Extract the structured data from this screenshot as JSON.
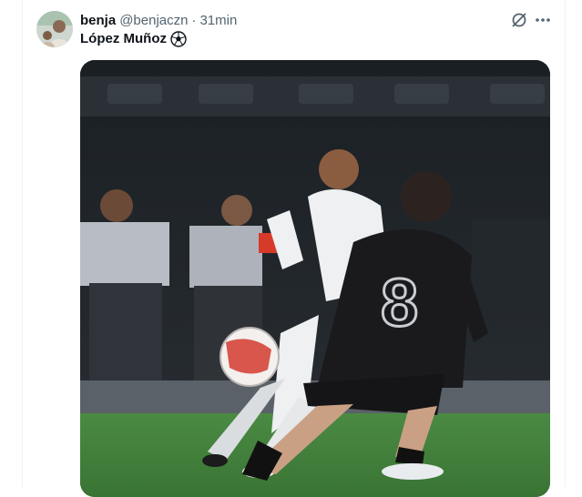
{
  "tweet": {
    "author_name": "benja",
    "author_handle": "@benjaczn",
    "separator": "·",
    "time": "31min",
    "text": "López Muñoz",
    "emoji": "soccer-ball-icon"
  },
  "icons": {
    "grok": "grok-icon",
    "more": "more-options-icon"
  },
  "colors": {
    "text_primary": "#0f1419",
    "text_secondary": "#536471",
    "pitch_green": "#3f7d3a"
  }
}
